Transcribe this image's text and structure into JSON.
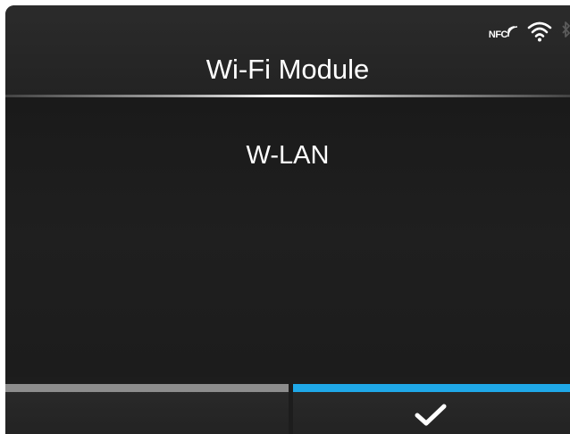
{
  "header": {
    "title": "Wi-Fi Module",
    "status_icons": {
      "nfc_label": "NFC",
      "icons": [
        "nfc-icon",
        "wifi-icon",
        "bluetooth-icon"
      ]
    }
  },
  "menu": {
    "items": [
      {
        "label": "W-LAN",
        "selected": true
      }
    ]
  },
  "softkeys": {
    "left": {
      "label": "",
      "bar_color": "#8d8d8d"
    },
    "right": {
      "icon": "check-icon",
      "bar_color": "#1fa8e8"
    }
  },
  "colors": {
    "background": "#1d1d1d",
    "text": "#ffffff",
    "accent": "#1fa8e8",
    "inactive_bar": "#8d8d8d"
  }
}
